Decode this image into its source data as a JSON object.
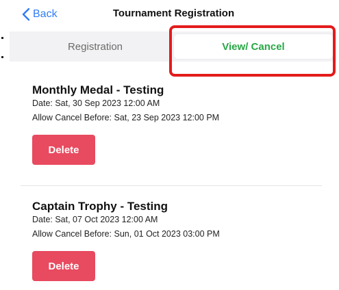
{
  "nav": {
    "back_label": "Back",
    "title": "Tournament Registration"
  },
  "tabs": [
    {
      "label": "Registration",
      "selected": false
    },
    {
      "label": "View/ Cancel",
      "selected": true
    }
  ],
  "registrations": [
    {
      "title": "Monthly Medal - Testing",
      "date": "Date: Sat, 30 Sep 2023 12:00 AM",
      "cancel_before": "Allow Cancel Before: Sat, 23 Sep 2023 12:00 PM",
      "delete_label": "Delete"
    },
    {
      "title": "Captain Trophy - Testing",
      "date": "Date: Sat, 07 Oct 2023 12:00 AM",
      "cancel_before": "Allow Cancel Before: Sun, 01 Oct 2023 03:00 PM",
      "delete_label": "Delete"
    }
  ],
  "colors": {
    "accent_blue": "#2f7cf6",
    "selected_tab_green": "#27a745",
    "delete_red": "#e84a5f",
    "highlight_red": "#e41b1b"
  },
  "icons": {
    "back": "chevron-left-icon"
  }
}
